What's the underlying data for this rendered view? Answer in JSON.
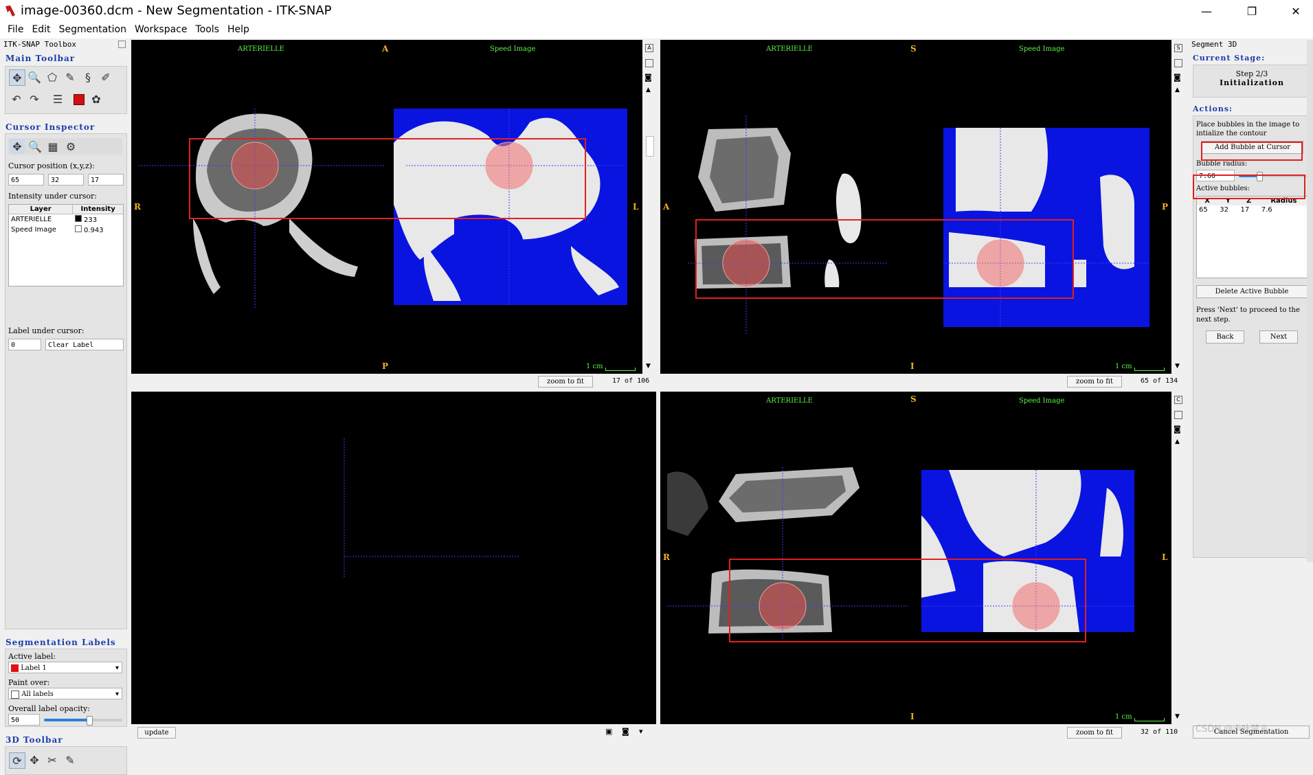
{
  "window": {
    "title": "image-00360.dcm - New Segmentation - ITK-SNAP",
    "minimize": "—",
    "maximize": "❐",
    "close": "✕"
  },
  "menu": [
    "File",
    "Edit",
    "Segmentation",
    "Workspace",
    "Tools",
    "Help"
  ],
  "toolbox": {
    "title": "ITK-SNAP Toolbox",
    "main_toolbar": "Main Toolbar",
    "cursor_inspector": "Cursor Inspector",
    "cursor_position_label": "Cursor position (x,y,z):",
    "cursor_x": "65",
    "cursor_y": "32",
    "cursor_z": "17",
    "intensity_label": "Intensity under cursor:",
    "layer_header": "Layer",
    "intensity_header": "Intensity",
    "layers": [
      {
        "name": "ARTERIELLE",
        "value": "233",
        "swatch": "#000000"
      },
      {
        "name": "Speed Image",
        "value": "0.943",
        "swatch": "#ffffff"
      }
    ],
    "label_under_cursor": "Label under cursor:",
    "label_value": "0",
    "label_name": "Clear Label",
    "seg_labels_title": "Segmentation Labels",
    "active_label_caption": "Active label:",
    "active_label": "Label 1",
    "paint_over_caption": "Paint over:",
    "paint_over": "All labels",
    "opacity_caption": "Overall label opacity:",
    "opacity_value": "50",
    "opacity_level": 0.58,
    "toolbar3d": "3D Toolbar"
  },
  "viewers": {
    "axial": {
      "layer1": "ARTERIELLE",
      "layer2": "Speed Image",
      "top": "A",
      "bottom": "P",
      "left": "R",
      "right": "L",
      "scale": "1 cm",
      "zoom": "zoom to fit",
      "slice": "17 of 106"
    },
    "sagittal": {
      "layer1": "ARTERIELLE",
      "layer2": "Speed Image",
      "top": "S",
      "bottom": "I",
      "left": "A",
      "right": "P",
      "scale": "1 cm",
      "zoom": "zoom to fit",
      "slice": "65 of 134"
    },
    "render3d": {
      "update": "update"
    },
    "coronal": {
      "layer1": "ARTERIELLE",
      "layer2": "Speed Image",
      "top": "S",
      "bottom": "I",
      "left": "R",
      "right": "L",
      "scale": "1 cm",
      "zoom": "zoom to fit",
      "slice": "32 of 110"
    }
  },
  "snake": {
    "title": "Segment 3D",
    "stage_caption": "Current Stage:",
    "step": "Step 2/3",
    "stage": "Initialization",
    "actions_caption": "Actions:",
    "instructions": "Place bubbles in the image to intialize the contour",
    "add_bubble": "Add Bubble at Cursor",
    "radius_caption": "Bubble radius:",
    "radius_value": "7.60",
    "radius_level": 0.3,
    "active_bubbles_caption": "Active bubbles:",
    "bubble_headers": [
      "X",
      "Y",
      "Z",
      "Radius"
    ],
    "bubbles": [
      {
        "x": "65",
        "y": "32",
        "z": "17",
        "r": "7.6"
      }
    ],
    "delete_bubble": "Delete Active Bubble",
    "next_instructions": "Press 'Next' to proceed to the next step.",
    "back": "Back",
    "next": "Next",
    "cancel": "Cancel Segmentation"
  },
  "watermark": "CSDN @卡咔禁言"
}
